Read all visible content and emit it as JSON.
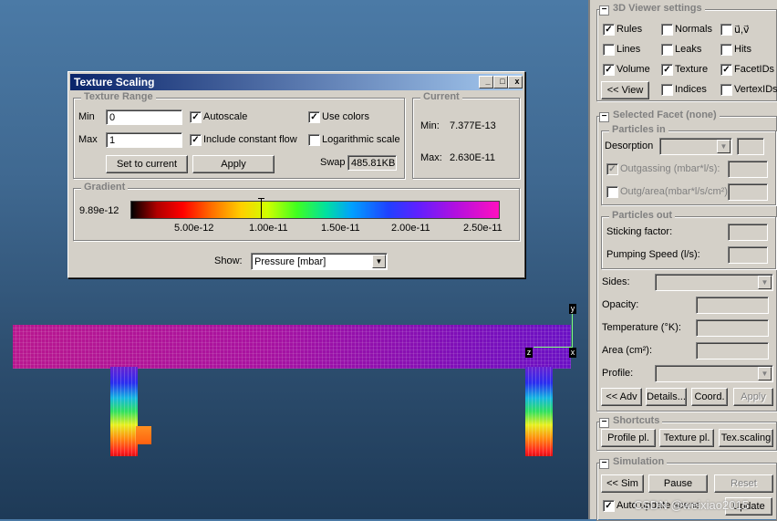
{
  "dialog": {
    "title": "Texture Scaling",
    "controls": {
      "minimize": "_",
      "maximize": "□",
      "close": "x"
    },
    "texture_range": {
      "label": "Texture Range",
      "min_label": "Min",
      "min_value": "0",
      "max_label": "Max",
      "max_value": "1",
      "autoscale": "Autoscale",
      "include_constant_flow": "Include constant flow",
      "use_colors": "Use colors",
      "log_scale": "Logarithmic scale",
      "swap_label": "Swap",
      "swap_value": "485.81KB",
      "set_to_current": "Set to current",
      "apply": "Apply"
    },
    "current": {
      "label": "Current",
      "min_label": "Min:",
      "min_value": "7.377E-13",
      "max_label": "Max:",
      "max_value": "2.630E-11"
    },
    "gradient": {
      "label": "Gradient",
      "start_value": "9.89e-12",
      "ticks": [
        "5.00e-12",
        "1.00e-11",
        "1.50e-11",
        "2.00e-11",
        "2.50e-11"
      ]
    },
    "show_label": "Show:",
    "show_value": "Pressure [mbar]"
  },
  "axes": {
    "y": "y",
    "z": "z",
    "x": "x"
  },
  "panel": {
    "viewer": {
      "header": "3D Viewer settings",
      "items": [
        "Rules",
        "Normals",
        "u⃗,v⃗",
        "Lines",
        "Leaks",
        "Hits",
        "Volume",
        "Texture",
        "FacetIDs",
        "Indices",
        "VertexIDs"
      ],
      "view_button": "<< View"
    },
    "facet": {
      "header": "Selected Facet (none)",
      "particles_in": "Particles in",
      "desorption": "Desorption",
      "outgassing": "Outgassing (mbar*l/s):",
      "outg_area": "Outg/area(mbar*l/s/cm²):",
      "particles_out": "Particles out",
      "sticking": "Sticking factor:",
      "pumping": "Pumping Speed (l/s):",
      "sides": "Sides:",
      "opacity": "Opacity:",
      "temperature": "Temperature (°K):",
      "area": "Area (cm²):",
      "profile": "Profile:",
      "buttons": [
        "<< Adv",
        "Details...",
        "Coord.",
        "Apply"
      ]
    },
    "shortcuts": {
      "header": "Shortcuts",
      "buttons": [
        "Profile pl.",
        "Texture pl.",
        "Tex.scaling"
      ]
    },
    "simulation": {
      "header": "Simulation",
      "buttons": [
        "<< Sim",
        "Pause",
        "Reset"
      ],
      "auto_update": "Auto update scene",
      "update_button": "Update",
      "watermark": "CSDN @weixiao2015"
    }
  }
}
